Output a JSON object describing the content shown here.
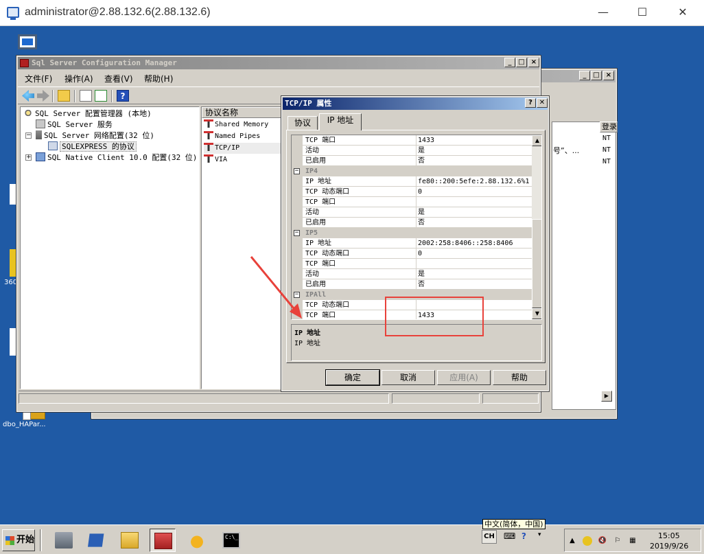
{
  "rdp": {
    "title": "administrator@2.88.132.6(2.88.132.6)",
    "minimize": "—",
    "maximize": "☐",
    "close": "✕"
  },
  "desktop": {
    "icon_db_label": "dbo_HAPar...",
    "icon_360_label": "360"
  },
  "back_window": {
    "column_header": "登录",
    "rows": [
      "NT",
      "NT",
      "NT"
    ],
    "snippet": "号”、..."
  },
  "main_window": {
    "title": "Sql Server Configuration Manager",
    "menu": [
      "文件(F)",
      "操作(A)",
      "查看(V)",
      "帮助(H)"
    ],
    "tree": {
      "root": "SQL Server 配置管理器 (本地)",
      "services": "SQL Server 服务",
      "network": "SQL Server 网络配置(32 位)",
      "protocols": "SQLEXPRESS 的协议",
      "client": "SQL Native Client 10.0 配置(32 位)"
    },
    "list_header": "协议名称",
    "protocols": [
      "Shared Memory",
      "Named Pipes",
      "TCP/IP",
      "VIA"
    ]
  },
  "dialog": {
    "title": "TCP/IP 属性",
    "help_btn": "?",
    "close_btn": "✕",
    "tabs": [
      "协议",
      "IP 地址"
    ],
    "grid": [
      {
        "type": "row",
        "key": "TCP 端口",
        "value": "1433"
      },
      {
        "type": "row",
        "key": "活动",
        "value": "是"
      },
      {
        "type": "row",
        "key": "已启用",
        "value": "否"
      },
      {
        "type": "cat",
        "key": "IP4"
      },
      {
        "type": "row",
        "key": "IP 地址",
        "value": "fe80::200:5efe:2.88.132.6%1"
      },
      {
        "type": "row",
        "key": "TCP 动态端口",
        "value": "0"
      },
      {
        "type": "row",
        "key": "TCP 端口",
        "value": ""
      },
      {
        "type": "row",
        "key": "活动",
        "value": "是"
      },
      {
        "type": "row",
        "key": "已启用",
        "value": "否"
      },
      {
        "type": "cat",
        "key": "IP5"
      },
      {
        "type": "row",
        "key": "IP 地址",
        "value": "2002:258:8406::258:8406"
      },
      {
        "type": "row",
        "key": "TCP 动态端口",
        "value": "0"
      },
      {
        "type": "row",
        "key": "TCP 端口",
        "value": ""
      },
      {
        "type": "row",
        "key": "活动",
        "value": "是"
      },
      {
        "type": "row",
        "key": "已启用",
        "value": "否"
      },
      {
        "type": "cat",
        "key": "IPAll"
      },
      {
        "type": "row",
        "key": "TCP 动态端口",
        "value": ""
      },
      {
        "type": "row",
        "key": "TCP 端口",
        "value": "1433"
      }
    ],
    "desc_title": "IP 地址",
    "desc_text": "IP 地址",
    "buttons": {
      "ok": "确定",
      "cancel": "取消",
      "apply": "应用(A)",
      "help": "帮助"
    }
  },
  "taskbar": {
    "start": "开始",
    "ime_tooltip": "中文(简体，中国)",
    "ime_lang": "CH",
    "clock_time": "15:05",
    "clock_date": "2019/9/26"
  },
  "colors": {
    "desktop": "#1f5aa5",
    "active_title": "#0a246a",
    "annotation": "#e8413a"
  }
}
